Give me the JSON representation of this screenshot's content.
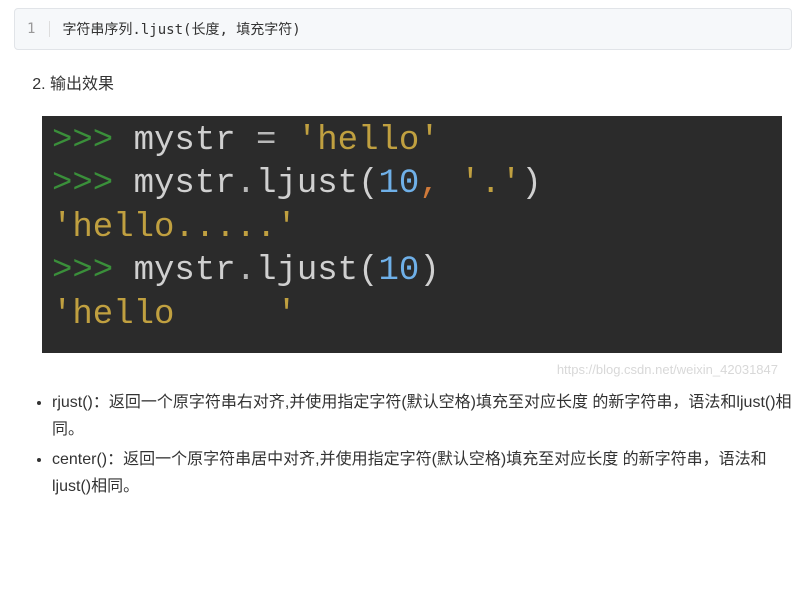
{
  "codebox": {
    "line_number": "1",
    "content": "字符串序列.ljust(长度, 填充字符)"
  },
  "output_list": {
    "start": 2,
    "item_label": "输出效果"
  },
  "terminal": {
    "lines": [
      {
        "tokens": [
          {
            "text": ">>> ",
            "cls": "p"
          },
          {
            "text": "mystr ",
            "cls": ""
          },
          {
            "text": "=",
            "cls": "eq"
          },
          {
            "text": " ",
            "cls": ""
          },
          {
            "text": "'hello'",
            "cls": "s"
          }
        ]
      },
      {
        "tokens": [
          {
            "text": ">>> ",
            "cls": "p"
          },
          {
            "text": "mystr",
            "cls": ""
          },
          {
            "text": ".",
            "cls": "dot"
          },
          {
            "text": "ljust",
            "cls": ""
          },
          {
            "text": "(",
            "cls": "par"
          },
          {
            "text": "10",
            "cls": "n"
          },
          {
            "text": ",",
            "cls": "o"
          },
          {
            "text": " ",
            "cls": ""
          },
          {
            "text": "'.'",
            "cls": "s"
          },
          {
            "text": ")",
            "cls": "par"
          }
        ]
      },
      {
        "tokens": [
          {
            "text": "'hello.....'",
            "cls": "s"
          }
        ]
      },
      {
        "tokens": [
          {
            "text": ">>> ",
            "cls": "p"
          },
          {
            "text": "mystr",
            "cls": ""
          },
          {
            "text": ".",
            "cls": "dot"
          },
          {
            "text": "ljust",
            "cls": ""
          },
          {
            "text": "(",
            "cls": "par"
          },
          {
            "text": "10",
            "cls": "n"
          },
          {
            "text": ")",
            "cls": "par"
          }
        ]
      },
      {
        "tokens": [
          {
            "text": "'hello     '",
            "cls": "s"
          }
        ]
      }
    ]
  },
  "watermark": "https://blog.csdn.net/weixin_42031847",
  "bullets": [
    "rjust()：返回一个原字符串右对齐,并使用指定字符(默认空格)填充至对应长度 的新字符串，语法和ljust()相同。",
    "center()：返回一个原字符串居中对齐,并使用指定字符(默认空格)填充至对应长度 的新字符串，语法和ljust()相同。"
  ]
}
